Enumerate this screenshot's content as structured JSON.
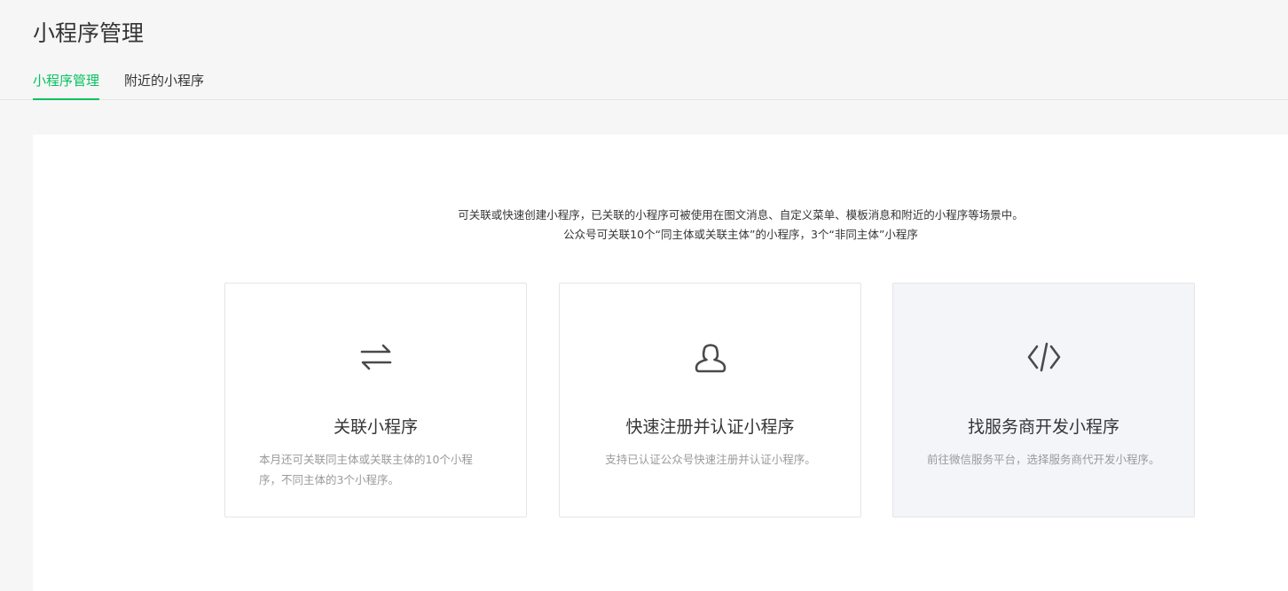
{
  "page": {
    "title": "小程序管理"
  },
  "tabs": [
    {
      "label": "小程序管理",
      "active": true
    },
    {
      "label": "附近的小程序",
      "active": false
    }
  ],
  "intro": {
    "line1": "可关联或快速创建小程序，已关联的小程序可被使用在图文消息、自定义菜单、模板消息和附近的小程序等场景中。",
    "line2": "公众号可关联10个“同主体或关联主体”的小程序，3个“非同主体”小程序"
  },
  "cards": [
    {
      "icon": "link-arrows-icon",
      "title": "关联小程序",
      "desc": "本月还可关联同主体或关联主体的10个小程序，不同主体的3个小程序。"
    },
    {
      "icon": "user-icon",
      "title": "快速注册并认证小程序",
      "desc": "支持已认证公众号快速注册并认证小程序。"
    },
    {
      "icon": "code-icon",
      "title": "找服务商开发小程序",
      "desc": "前往微信服务平台，选择服务商代开发小程序。"
    }
  ],
  "colors": {
    "accent": "#07c160",
    "text": "#353535",
    "muted": "#9a9a9a",
    "background": "#f6f6f6",
    "card_hover": "#f4f5f9"
  }
}
